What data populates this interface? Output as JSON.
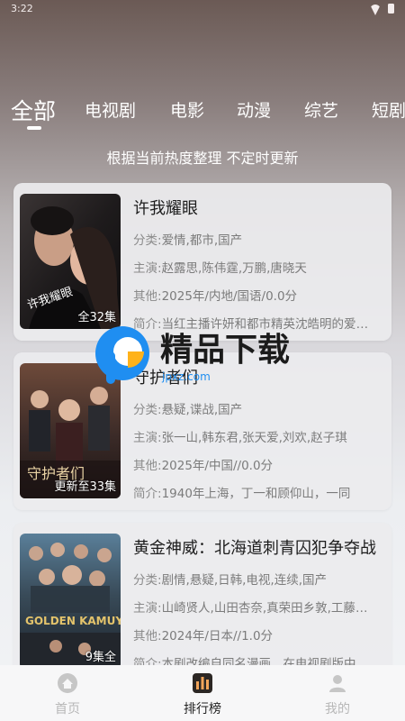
{
  "status": {
    "time": "3:22"
  },
  "tabs": [
    {
      "label": "全部",
      "active": true
    },
    {
      "label": "电视剧"
    },
    {
      "label": "电影"
    },
    {
      "label": "动漫"
    },
    {
      "label": "综艺"
    },
    {
      "label": "短剧"
    }
  ],
  "subtitle": "根据当前热度整理 不定时更新",
  "labels": {
    "category": "分类:",
    "cast": "主演:",
    "other": "其他:",
    "intro": "简介:"
  },
  "cards": [
    {
      "title": "许我耀眼",
      "category": "爱情,都市,国产",
      "cast": "赵露思,陈伟霆,万鹏,唐晓天",
      "other": "2025年/内地/国语/0.0分",
      "intro": "当红主播许妍和都市精英沈皓明的爱情故事",
      "badge": "全32集",
      "poster_text": "许我耀眼"
    },
    {
      "title": "守护者们",
      "category": "悬疑,谍战,国产",
      "cast": "张一山,韩东君,张天爱,刘欢,赵子琪",
      "other": "2025年/中国//0.0分",
      "intro": "1940年上海，丁一和顾仰山，一同",
      "badge": "更新至33集",
      "poster_text": "守护者们"
    },
    {
      "title": "黄金神威：北海道刺青囚犯争夺战",
      "category": "剧情,悬疑,日韩,电视,连续,国产",
      "cast": "山崎贤人,山田杏奈,真荣田乡敦,工藤阿须加",
      "other": "2024年/日本//1.0分",
      "intro": "本剧改编自同名漫画，在电视剧版中",
      "badge": "9集全",
      "poster_text": "GOLDEN KAMUY"
    }
  ],
  "watermark": {
    "text": "精品下载",
    "url": "jpxz.com"
  },
  "nav": [
    {
      "label": "首页",
      "icon": "home-icon"
    },
    {
      "label": "排行榜",
      "icon": "ranking-icon",
      "active": true
    },
    {
      "label": "我的",
      "icon": "profile-icon"
    }
  ]
}
